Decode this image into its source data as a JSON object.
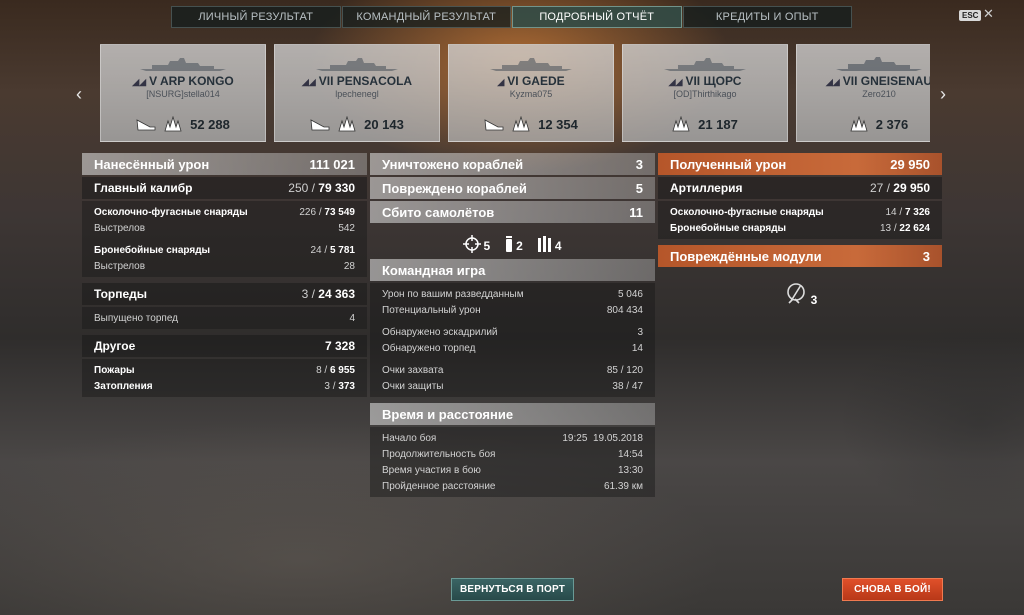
{
  "tabs": [
    {
      "label": "ЛИЧНЫЙ РЕЗУЛЬТАТ",
      "active": false
    },
    {
      "label": "КОМАНДНЫЙ РЕЗУЛЬТАТ",
      "active": false
    },
    {
      "label": "ПОДРОБНЫЙ ОТЧЁТ",
      "active": true
    },
    {
      "label": "КРЕДИТЫ И ОПЫТ",
      "active": false
    }
  ],
  "esc_label": "ESC",
  "close_glyph": "✕",
  "nav": {
    "prev_glyph": "‹",
    "next_glyph": "›"
  },
  "ships": [
    {
      "name": "V ARP KONGO",
      "player": "[NSURG]stella014",
      "damage": "52 288",
      "icons": [
        "torpedo-hit-icon",
        "fire-burst-icon"
      ]
    },
    {
      "name": "VII PENSACOLA",
      "player": "lpechenegl",
      "damage": "20 143",
      "icons": [
        "torpedo-hit-icon",
        "fire-burst-icon"
      ]
    },
    {
      "name": "VI GAEDE",
      "player": "Kyzma075",
      "damage": "12 354",
      "icons": [
        "torpedo-hit-icon",
        "fire-burst-icon"
      ]
    },
    {
      "name": "VII ЩОРС",
      "player": "[OD]Thirthikago",
      "damage": "21 187",
      "icons": [
        "fire-burst-icon"
      ]
    },
    {
      "name": "VII GNEISENAU",
      "player": "Zero210",
      "damage": "2 376",
      "icons": [
        "fire-burst-icon"
      ]
    }
  ],
  "left": {
    "dealt": {
      "label": "Нанесённый урон",
      "value": "111 021"
    },
    "main_battery": {
      "label": "Главный калибр",
      "value_a": "250 / ",
      "value_b": "79 330"
    },
    "he": {
      "label": "Осколочно-фугасные снаряды",
      "a": "226 / ",
      "b": "73 549"
    },
    "he_shots": {
      "label": "Выстрелов",
      "value": "542"
    },
    "ap": {
      "label": "Бронебойные снаряды",
      "a": "24 / ",
      "b": "5 781"
    },
    "ap_shots": {
      "label": "Выстрелов",
      "value": "28"
    },
    "torpedoes": {
      "label": "Торпеды",
      "value_a": "3 / ",
      "value_b": "24 363"
    },
    "torp_launched": {
      "label": "Выпущено торпед",
      "value": "4"
    },
    "other": {
      "label": "Другое",
      "value": "7 328"
    },
    "fires": {
      "label": "Пожары",
      "a": "8 / ",
      "b": "6 955"
    },
    "floods": {
      "label": "Затопления",
      "a": "3 / ",
      "b": "373"
    }
  },
  "middle": {
    "destroyed": {
      "label": "Уничтожено кораблей",
      "value": "3"
    },
    "damaged": {
      "label": "Повреждено кораблей",
      "value": "5"
    },
    "planes": {
      "label": "Сбито самолётов",
      "value": "11"
    },
    "badges": [
      {
        "icon": "crosshair-icon",
        "value": "5"
      },
      {
        "icon": "shell-icon",
        "value": "2"
      },
      {
        "icon": "ammo-rack-icon",
        "value": "4"
      }
    ],
    "team": {
      "title": "Командная игра",
      "rows": [
        {
          "label": "Урон по вашим разведданным",
          "value": "5 046"
        },
        {
          "label": "Потенциальный урон",
          "value": "804 434"
        },
        {
          "label": "Обнаружено эскадрилий",
          "value": "3"
        },
        {
          "label": "Обнаружено торпед",
          "value": "14"
        },
        {
          "label": "Очки захвата",
          "value": "85 / 120"
        },
        {
          "label": "Очки защиты",
          "value": "38 / 47"
        }
      ]
    },
    "time": {
      "title": "Время и расстояние",
      "rows": [
        {
          "label": "Начало боя",
          "value": "19:25  19.05.2018"
        },
        {
          "label": "Продолжительность боя",
          "value": "14:54"
        },
        {
          "label": "Время участия в бою",
          "value": "13:30"
        },
        {
          "label": "Пройденное расстояние",
          "value": "61.39 км"
        }
      ]
    }
  },
  "right": {
    "received": {
      "label": "Полученный урон",
      "value": "29 950"
    },
    "artillery": {
      "label": "Артиллерия",
      "value_a": "27 / ",
      "value_b": "29 950"
    },
    "he": {
      "label": "Осколочно-фугасные снаряды",
      "a": "14 / ",
      "b": "7 326"
    },
    "ap": {
      "label": "Бронебойные снаряды",
      "a": "13 / ",
      "b": "22 624"
    },
    "modules": {
      "label": "Повреждённые модули",
      "value": "3"
    },
    "modules_icon_value": "3"
  },
  "buttons": {
    "port": "ВЕРНУТЬСЯ В ПОРТ",
    "battle": "СНОВА В БОЙ!"
  },
  "colors": {
    "accent_orange": "#c86a3a",
    "port_button": "#3a6464",
    "battle_button": "#e0502a"
  }
}
